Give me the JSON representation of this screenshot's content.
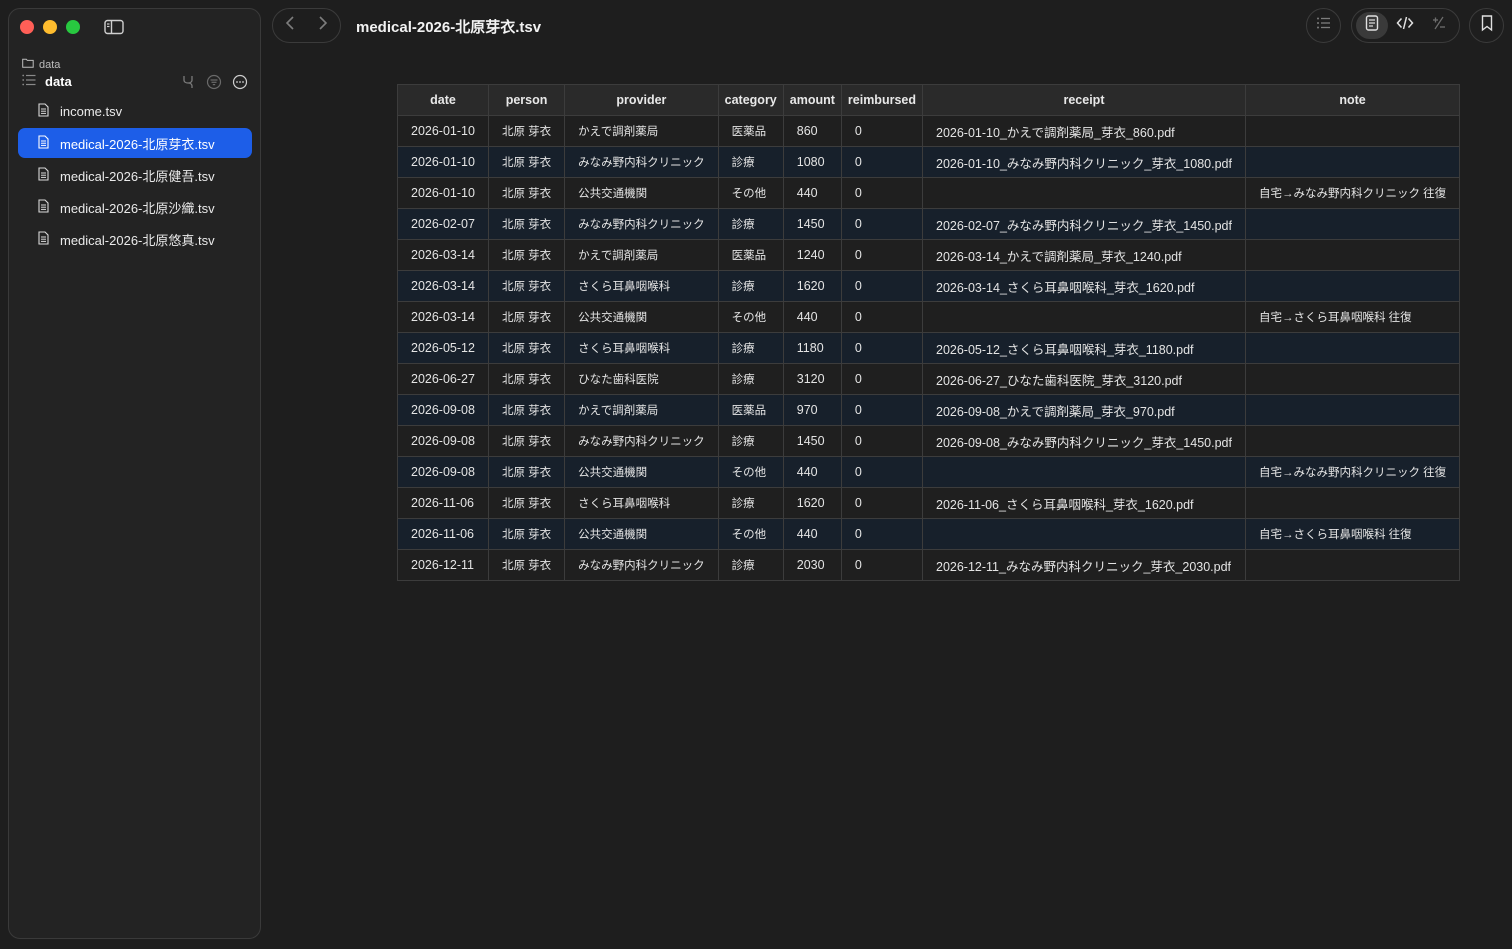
{
  "window": {
    "title": "medical-2026-北原芽衣.tsv"
  },
  "sidebar": {
    "breadcrumb": "data",
    "folder_title": "data",
    "files": [
      {
        "name": "income.tsv",
        "active": false
      },
      {
        "name": "medical-2026-北原芽衣.tsv",
        "active": true
      },
      {
        "name": "medical-2026-北原健吾.tsv",
        "active": false
      },
      {
        "name": "medical-2026-北原沙織.tsv",
        "active": false
      },
      {
        "name": "medical-2026-北原悠真.tsv",
        "active": false
      }
    ]
  },
  "toolbar": {
    "icons": [
      "list-icon",
      "preview-icon",
      "code-icon",
      "diff-icon",
      "bookmark-icon"
    ],
    "active_view": "preview"
  },
  "colors": {
    "accent": "#1d5ee8",
    "row_alt": "#17202b"
  },
  "table": {
    "columns": [
      "date",
      "person",
      "provider",
      "category",
      "amount",
      "reimbursed",
      "receipt",
      "note"
    ],
    "rows": [
      [
        "2026-01-10",
        "北原 芽衣",
        "かえで調剤薬局",
        "医薬品",
        "860",
        "0",
        "2026-01-10_かえで調剤薬局_芽衣_860.pdf",
        ""
      ],
      [
        "2026-01-10",
        "北原 芽衣",
        "みなみ野内科クリニック",
        "診療",
        "1080",
        "0",
        "2026-01-10_みなみ野内科クリニック_芽衣_1080.pdf",
        ""
      ],
      [
        "2026-01-10",
        "北原 芽衣",
        "公共交通機関",
        "その他",
        "440",
        "0",
        "",
        "自宅→みなみ野内科クリニック 往復"
      ],
      [
        "2026-02-07",
        "北原 芽衣",
        "みなみ野内科クリニック",
        "診療",
        "1450",
        "0",
        "2026-02-07_みなみ野内科クリニック_芽衣_1450.pdf",
        ""
      ],
      [
        "2026-03-14",
        "北原 芽衣",
        "かえで調剤薬局",
        "医薬品",
        "1240",
        "0",
        "2026-03-14_かえで調剤薬局_芽衣_1240.pdf",
        ""
      ],
      [
        "2026-03-14",
        "北原 芽衣",
        "さくら耳鼻咽喉科",
        "診療",
        "1620",
        "0",
        "2026-03-14_さくら耳鼻咽喉科_芽衣_1620.pdf",
        ""
      ],
      [
        "2026-03-14",
        "北原 芽衣",
        "公共交通機関",
        "その他",
        "440",
        "0",
        "",
        "自宅→さくら耳鼻咽喉科 往復"
      ],
      [
        "2026-05-12",
        "北原 芽衣",
        "さくら耳鼻咽喉科",
        "診療",
        "1180",
        "0",
        "2026-05-12_さくら耳鼻咽喉科_芽衣_1180.pdf",
        ""
      ],
      [
        "2026-06-27",
        "北原 芽衣",
        "ひなた歯科医院",
        "診療",
        "3120",
        "0",
        "2026-06-27_ひなた歯科医院_芽衣_3120.pdf",
        ""
      ],
      [
        "2026-09-08",
        "北原 芽衣",
        "かえで調剤薬局",
        "医薬品",
        "970",
        "0",
        "2026-09-08_かえで調剤薬局_芽衣_970.pdf",
        ""
      ],
      [
        "2026-09-08",
        "北原 芽衣",
        "みなみ野内科クリニック",
        "診療",
        "1450",
        "0",
        "2026-09-08_みなみ野内科クリニック_芽衣_1450.pdf",
        ""
      ],
      [
        "2026-09-08",
        "北原 芽衣",
        "公共交通機関",
        "その他",
        "440",
        "0",
        "",
        "自宅→みなみ野内科クリニック 往復"
      ],
      [
        "2026-11-06",
        "北原 芽衣",
        "さくら耳鼻咽喉科",
        "診療",
        "1620",
        "0",
        "2026-11-06_さくら耳鼻咽喉科_芽衣_1620.pdf",
        ""
      ],
      [
        "2026-11-06",
        "北原 芽衣",
        "公共交通機関",
        "その他",
        "440",
        "0",
        "",
        "自宅→さくら耳鼻咽喉科 往復"
      ],
      [
        "2026-12-11",
        "北原 芽衣",
        "みなみ野内科クリニック",
        "診療",
        "2030",
        "0",
        "2026-12-11_みなみ野内科クリニック_芽衣_2030.pdf",
        ""
      ]
    ]
  }
}
